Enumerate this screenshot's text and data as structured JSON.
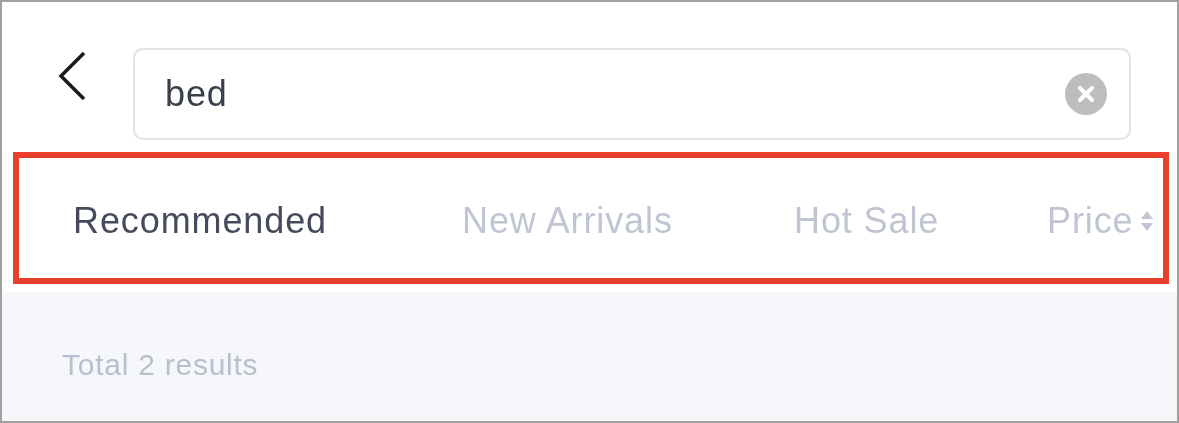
{
  "search": {
    "value": "bed"
  },
  "tabs": [
    {
      "label": "Recommended",
      "selected": true
    },
    {
      "label": "New Arrivals",
      "selected": false
    },
    {
      "label": "Hot Sale",
      "selected": false
    },
    {
      "label": "Price",
      "selected": false,
      "kind": "sort"
    }
  ],
  "results_summary": "Total 2 results"
}
